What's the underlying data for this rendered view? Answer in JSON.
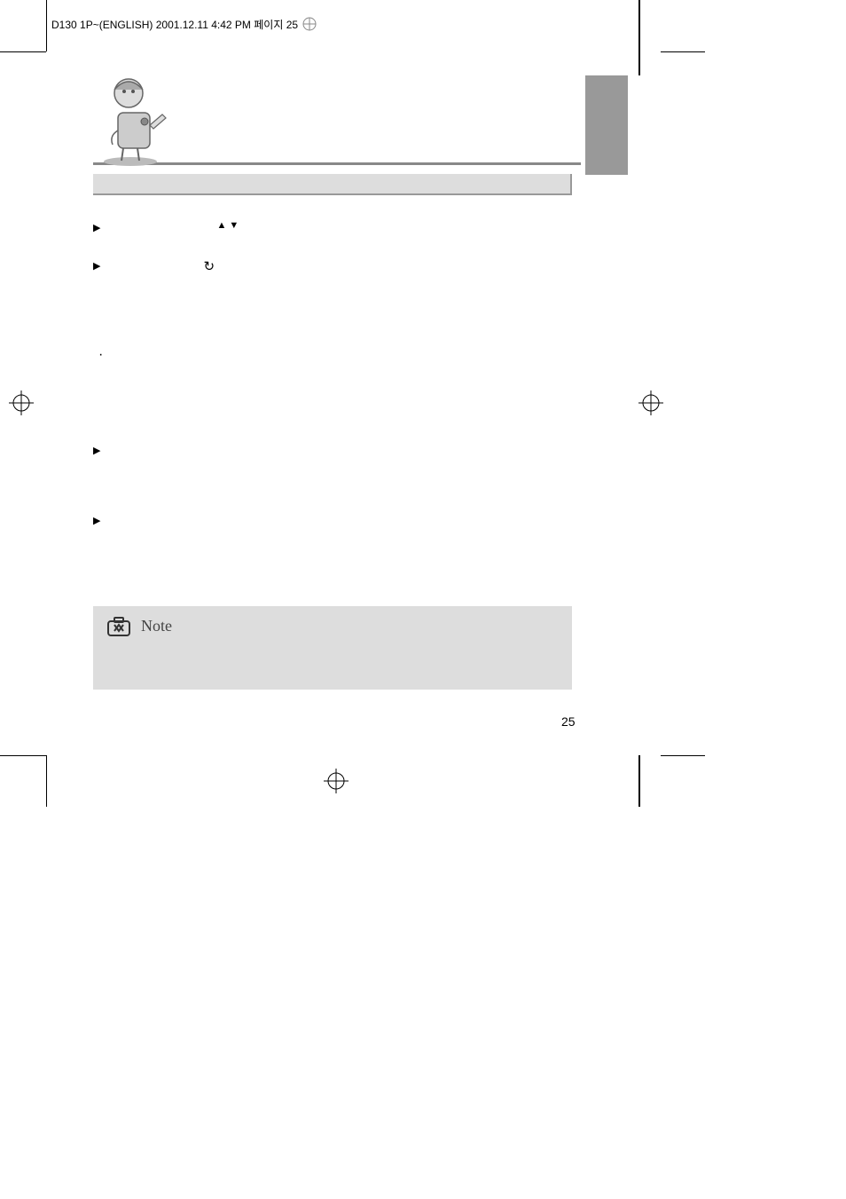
{
  "header": {
    "stamp": "D130 1P~(ENGLISH)  2001.12.11  4:42 PM  페이지 25"
  },
  "note": {
    "label": "Note"
  },
  "page_number": "25"
}
